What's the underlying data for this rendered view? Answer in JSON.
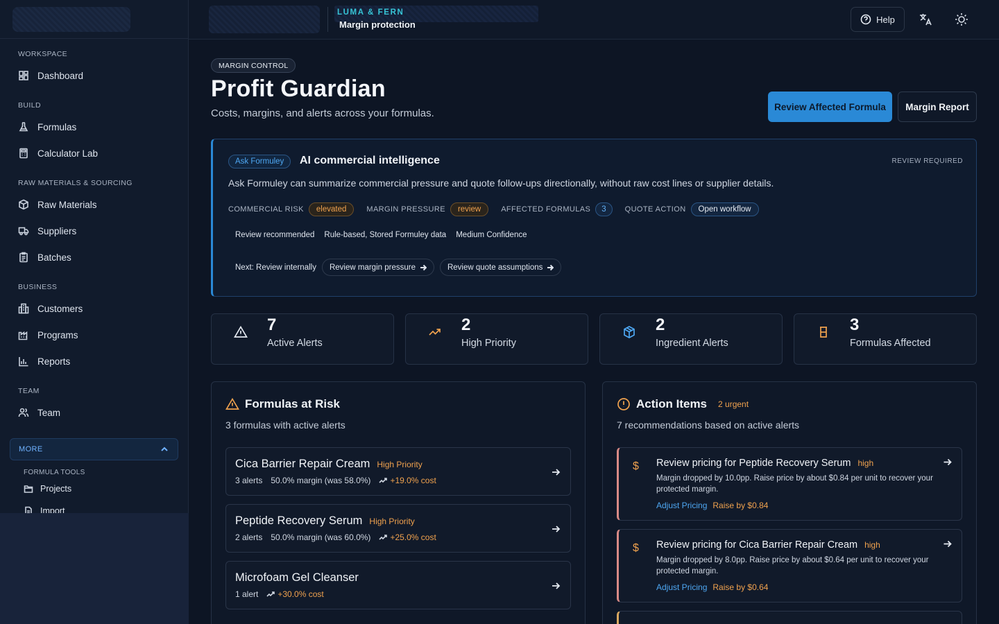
{
  "sidebar": {
    "sections": [
      {
        "title": "WORKSPACE",
        "items": [
          {
            "label": "Dashboard",
            "icon": "dashboard-icon"
          }
        ]
      },
      {
        "title": "BUILD",
        "items": [
          {
            "label": "Formulas",
            "icon": "flask-icon"
          },
          {
            "label": "Calculator Lab",
            "icon": "calculator-icon"
          }
        ]
      },
      {
        "title": "RAW MATERIALS & SOURCING",
        "items": [
          {
            "label": "Raw Materials",
            "icon": "box-icon"
          },
          {
            "label": "Suppliers",
            "icon": "truck-icon"
          },
          {
            "label": "Batches",
            "icon": "clipboard-icon"
          }
        ]
      },
      {
        "title": "BUSINESS",
        "items": [
          {
            "label": "Customers",
            "icon": "building-icon"
          },
          {
            "label": "Programs",
            "icon": "factory-icon"
          },
          {
            "label": "Reports",
            "icon": "bar-chart-icon"
          }
        ]
      },
      {
        "title": "TEAM",
        "items": [
          {
            "label": "Team",
            "icon": "users-icon"
          }
        ]
      }
    ],
    "more_label": "MORE",
    "tools_section": "FORMULA TOOLS",
    "tools": [
      {
        "label": "Projects"
      },
      {
        "label": "Import"
      }
    ]
  },
  "topbar": {
    "brand": "LUMA & FERN",
    "subtitle": "Margin protection",
    "help_label": "Help"
  },
  "header": {
    "tag": "MARGIN CONTROL",
    "title": "Profit Guardian",
    "subtitle": "Costs, margins, and alerts across your formulas.",
    "primary_button": "Review Affected Formula",
    "secondary_button": "Margin Report"
  },
  "ai_card": {
    "ask_label": "Ask Formuley",
    "title": "AI commercial intelligence",
    "review_required": "REVIEW REQUIRED",
    "description": "Ask Formuley can summarize commercial pressure and quote follow-ups directionally, without raw cost lines or supplier details.",
    "metrics": [
      {
        "label": "COMMERCIAL RISK",
        "value": "elevated"
      },
      {
        "label": "MARGIN PRESSURE",
        "value": "review"
      },
      {
        "label": "AFFECTED FORMULAS",
        "value": "3"
      },
      {
        "label": "QUOTE ACTION",
        "value": "Open workflow"
      }
    ],
    "chips": [
      "Review recommended",
      "Rule-based, Stored Formuley data",
      "Medium Confidence"
    ],
    "next_label": "Next: Review internally",
    "next_actions": [
      "Review margin pressure",
      "Review quote assumptions"
    ]
  },
  "stats": [
    {
      "value": "7",
      "label": "Active Alerts",
      "icon": "warning-icon",
      "color": "#e6ebf2"
    },
    {
      "value": "2",
      "label": "High Priority",
      "icon": "trending-up-icon",
      "color": "#f0a24e"
    },
    {
      "value": "2",
      "label": "Ingredient Alerts",
      "icon": "package-icon",
      "color": "#4ea7f2"
    },
    {
      "value": "3",
      "label": "Formulas Affected",
      "icon": "beaker-icon",
      "color": "#f0a24e"
    }
  ],
  "formulas_panel": {
    "title": "Formulas at Risk",
    "subtitle": "3 formulas with active alerts",
    "rows": [
      {
        "name": "Cica Barrier Repair Cream",
        "priority": "High Priority",
        "alerts": "3 alerts",
        "margin": "50.0% margin (was 58.0%)",
        "cost": "+19.0% cost"
      },
      {
        "name": "Peptide Recovery Serum",
        "priority": "High Priority",
        "alerts": "2 alerts",
        "margin": "50.0% margin (was 60.0%)",
        "cost": "+25.0% cost"
      },
      {
        "name": "Microfoam Gel Cleanser",
        "priority": "",
        "alerts": "1 alert",
        "margin": "",
        "cost": "+30.0% cost"
      }
    ]
  },
  "actions_panel": {
    "title": "Action Items",
    "badge": "2 urgent",
    "subtitle": "7 recommendations based on active alerts",
    "items": [
      {
        "title": "Review pricing for Peptide Recovery Serum",
        "level": "high",
        "body": "Margin dropped by 10.0pp. Raise price by about $0.84 per unit to recover your protected margin.",
        "link": "Adjust Pricing",
        "raise": "Raise by $0.84"
      },
      {
        "title": "Review pricing for Cica Barrier Repair Cream",
        "level": "high",
        "body": "Margin dropped by 8.0pp. Raise price by about $0.64 per unit to recover your protected margin.",
        "link": "Adjust Pricing",
        "raise": "Raise by $0.64"
      }
    ]
  }
}
